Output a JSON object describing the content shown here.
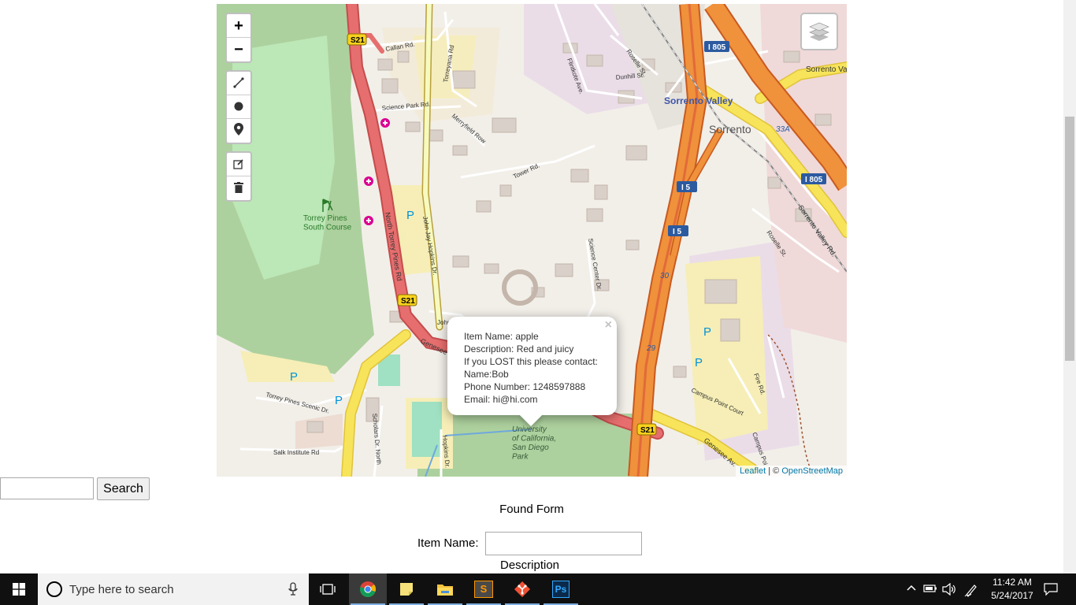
{
  "map": {
    "zoom_in": "+",
    "zoom_out": "−",
    "attribution_leaflet": "Leaflet",
    "attribution_sep": " | © ",
    "attribution_osm": "OpenStreetMap",
    "labels": {
      "sorrento_valley": "Sorrento Valley",
      "sorrento": "Sorrento",
      "i805_a": "I 805",
      "i805_b": "I 805",
      "i5_a": "I 5",
      "i5_b": "I 5",
      "s21_a": "S21",
      "s21_b": "S21",
      "s21_c": "S21",
      "route30": "30",
      "route29": "29",
      "route33a": "33A",
      "sorrento_va": "Sorrento Va",
      "callan": "Callan Rd.",
      "torreyana": "Torreyana Rd",
      "science_park": "Science Park Rd.",
      "merryfield": "Merryfield Row",
      "tower": "Tower Rd.",
      "flintkote": "Flintkote Ave.",
      "roselle": "Roselle St.",
      "roselle2": "Roselle St.",
      "dunhill": "Dunhill St.",
      "north_torrey": "North Torrey Pines Rd",
      "john_jay": "John Jay Hopkins Dr.",
      "john_jay2": "John J",
      "science_center": "Science Center Dr.",
      "sorrento_valley_rd": "Sorrento Valley Rd.",
      "genesee": "Genesee",
      "genesee2": "Genesee Av.",
      "torrey_scenic": "Torrey Pines Scenic Dr.",
      "salk": "Salk Institute Rd",
      "scholars": "Scholars Dr. North",
      "hopkins": "Hopkins Dr.",
      "campus_point": "Campus Point Court",
      "campus_point2": "Campus Poi",
      "fire_rd": "Fire Rd.",
      "golf": "Torrey Pines\nSouth Course",
      "ucsd": "University\nof California,\nSan Diego\nPark",
      "parking": "P"
    }
  },
  "popup": {
    "close": "×",
    "item_name": "Item Name: apple",
    "description": "Description: Red and juicy",
    "contact_intro": "If you LOST this please contact:",
    "name": "Name:Bob",
    "phone": "Phone Number: 1248597888",
    "email": "Email: hi@hi.com"
  },
  "search": {
    "value": "",
    "button": "Search"
  },
  "form": {
    "title": "Found Form",
    "item_name_label": "Item Name:",
    "item_name_value": "",
    "description_label": "Description"
  },
  "taskbar": {
    "search_placeholder": "Type here to search",
    "time": "11:42 AM",
    "date": "5/24/2017",
    "apps": [
      "chrome-icon",
      "sticky-notes-icon",
      "file-explorer-icon",
      "sublime-text-icon",
      "git-icon",
      "photoshop-icon"
    ],
    "photoshop_label": "Ps",
    "sublime_label": "S"
  }
}
